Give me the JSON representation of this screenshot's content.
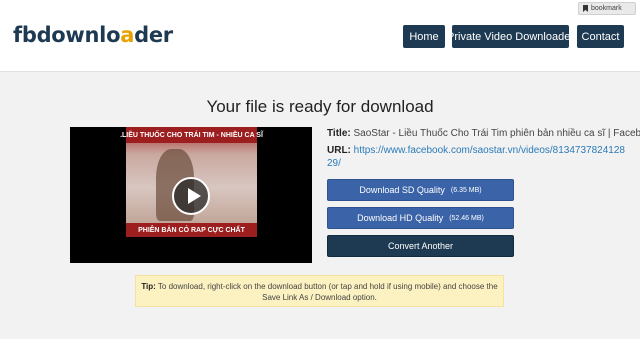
{
  "header": {
    "logo_text_1": "fbdownlo",
    "logo_text_o": "a",
    "logo_text_2": "der",
    "nav": [
      {
        "label": "Home"
      },
      {
        "label": "Private Video Downloader"
      },
      {
        "label": "Contact"
      }
    ]
  },
  "browser": {
    "bookmark_label": "bookmark"
  },
  "main": {
    "headline": "Your file is ready for download",
    "thumbnail": {
      "top_caption": ".LIỀU THUỐC CHO TRÁI TIM - NHIỀU CA SĨ",
      "bottom_caption": "PHIÊN BẢN CÓ RAP CỰC CHẤT"
    },
    "title_label": "Title:",
    "title_value": "SaoStar - Liều Thuốc Cho Trái Tim phiên bản nhiều ca sĩ | Facebook",
    "url_label": "URL:",
    "url_value": "https://www.facebook.com/saostar.vn/videos/813473782412829/",
    "buttons": {
      "sd_label": "Download SD Quality",
      "sd_size": "(6.35 MB)",
      "hd_label": "Download HD Quality",
      "hd_size": "(52.46 MB)",
      "convert_label": "Convert Another"
    },
    "tip": {
      "label": "Tip:",
      "text": "To download, right-click on the download button (or tap and hold if using mobile) and choose the Save Link As / Download option."
    }
  },
  "colors": {
    "brand_dark": "#1e3a52",
    "accent_yellow": "#e8a200",
    "button_blue": "#3a63a8",
    "tip_bg": "#fcf1c0"
  }
}
